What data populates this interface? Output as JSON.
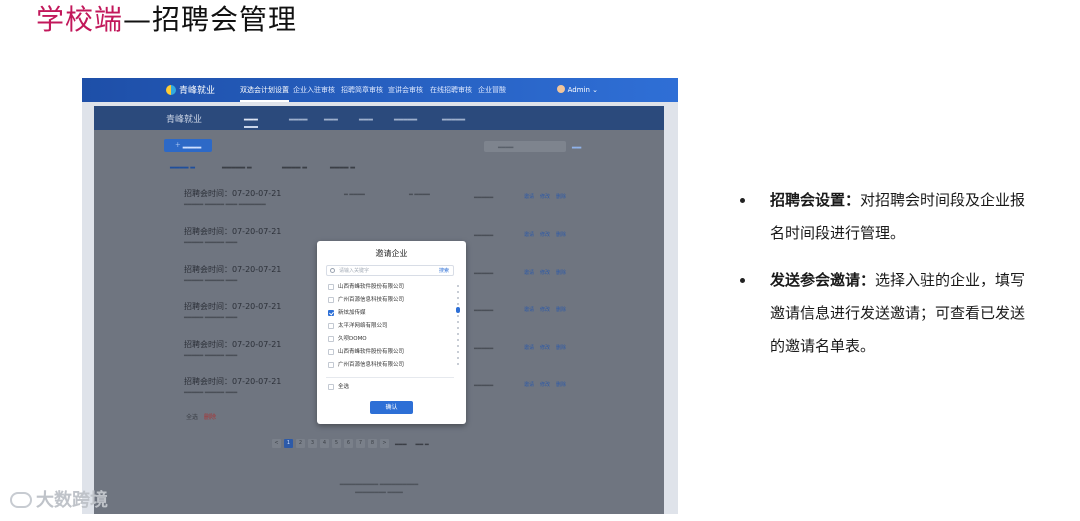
{
  "slide": {
    "title_highlight": "学校端",
    "title_rest": "—招聘会管理"
  },
  "bullets": [
    {
      "label": "招聘会设置：",
      "text": "对招聘会时间段及企业报名时间段进行管理。"
    },
    {
      "label": "发送参会邀请：",
      "text": "选择入驻的企业，填写邀请信息进行发送邀请；可查看已发送的邀请名单表。"
    }
  ],
  "app": {
    "logo": "青峰就业",
    "nav": [
      "双选会计划设置",
      "企业入驻审核",
      "招聘简章审核",
      "宣讲会审核",
      "在线招聘审核",
      "企业冒酸"
    ],
    "user": "Admin",
    "inner_logo": "青峰就业",
    "rows": [
      {
        "title": "招聘会时间：07-20-07-21"
      },
      {
        "title": "招聘会时间：07-20-07-21"
      },
      {
        "title": "招聘会时间：07-20-07-21"
      },
      {
        "title": "招聘会时间：07-20-07-21"
      },
      {
        "title": "招聘会时间：07-20-07-21"
      },
      {
        "title": "招聘会时间：07-20-07-21"
      }
    ],
    "actions": [
      "邀请",
      "修改",
      "删除"
    ],
    "bulk_select": "全选",
    "bulk_delete": "删除",
    "pages": [
      "<",
      "1",
      "2",
      "3",
      "4",
      "5",
      "6",
      "7",
      "8",
      ">"
    ],
    "current_page": "1"
  },
  "modal": {
    "title": "邀请企业",
    "search_placeholder": "请输入关键字",
    "search_button": "搜索",
    "companies": [
      {
        "name": "山西青峰软件股份有限公司",
        "checked": false
      },
      {
        "name": "广州百源信息科技有限公司",
        "checked": false
      },
      {
        "name": "新炫加传媒",
        "checked": true
      },
      {
        "name": "太平洋网络有限公司",
        "checked": false
      },
      {
        "name": "久呗DOMO",
        "checked": false
      },
      {
        "name": "山西青峰软件股份有限公司",
        "checked": false
      },
      {
        "name": "广州百源信息科技有限公司",
        "checked": false
      }
    ],
    "select_all": "全选",
    "confirm": "确认"
  },
  "watermark": "大数跨境",
  "colors": {
    "accent": "#2d6fd6",
    "title_highlight": "#c2185b"
  }
}
